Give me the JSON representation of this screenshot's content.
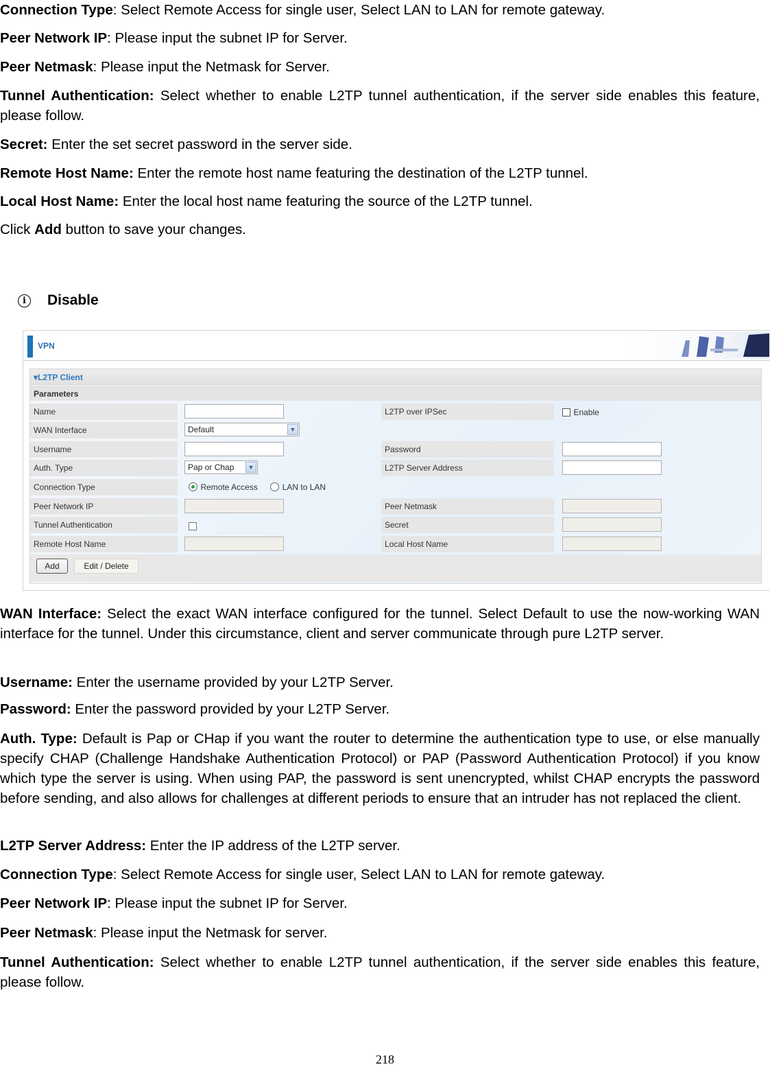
{
  "top_paragraphs": [
    {
      "term": "Connection Type",
      "sep": ":",
      "text": " Select Remote Access for single user, Select LAN to LAN for remote gateway."
    },
    {
      "term": "Peer Network IP",
      "sep": ":",
      "text": " Please input the subnet IP for Server."
    },
    {
      "term": "Peer Netmask",
      "sep": ":",
      "text": " Please input the Netmask for Server."
    },
    {
      "term": "Tunnel Authentication:",
      "sep": "",
      "text": " Select whether to enable L2TP tunnel authentication, if the server side enables this feature, please follow."
    },
    {
      "term": "Secret:",
      "sep": "",
      "text": " Enter the set secret password in the server side."
    },
    {
      "term": "Remote Host Name:",
      "sep": "",
      "text": " Enter the remote host name featuring the destination of the L2TP tunnel."
    },
    {
      "term": "Local Host Name:",
      "sep": "",
      "text": " Enter the local host name featuring the source of the L2TP tunnel."
    }
  ],
  "click_add": {
    "prefix": "Click ",
    "term": "Add",
    "suffix": " button to save your changes."
  },
  "section": {
    "icon": "info-icon",
    "title": "Disable"
  },
  "ui": {
    "header_title": "VPN",
    "accent_color": "#1f73b7",
    "client_title": "▾L2TP Client",
    "params_title": "Parameters",
    "rows": [
      {
        "left_label": "Name",
        "right_label": "L2TP over IPSec",
        "right_option": "Enable"
      },
      {
        "left_label": "WAN Interface",
        "left_value": "Default"
      },
      {
        "left_label": "Username",
        "right_label": "Password"
      },
      {
        "left_label": "Auth. Type",
        "left_value": "Pap or Chap",
        "right_label": "L2TP Server Address"
      },
      {
        "left_label": "Connection Type",
        "options": [
          "Remote Access",
          "LAN to LAN"
        ],
        "selected": "Remote Access"
      },
      {
        "left_label": "Peer Network IP",
        "right_label": "Peer Netmask"
      },
      {
        "left_label": "Tunnel Authentication",
        "right_label": "Secret"
      },
      {
        "left_label": "Remote Host Name",
        "right_label": "Local Host Name"
      }
    ],
    "buttons": {
      "add": "Add",
      "edit_delete": "Edit / Delete"
    }
  },
  "bottom_paragraphs": [
    {
      "term": "WAN Interface:",
      "sep": "",
      "text": " Select the exact WAN interface configured for the tunnel. Select Default to use the now-working WAN interface for the tunnel. Under this circumstance, client and server communicate through pure L2TP server."
    },
    {
      "term": "Username:",
      "sep": "",
      "text": " Enter the username provided by your L2TP Server."
    },
    {
      "term": "Password:",
      "sep": "",
      "text": " Enter the password provided by your L2TP Server."
    },
    {
      "term": "Auth. Type:",
      "sep": "",
      "text": " Default is Pap or CHap if you want the router to determine the authentication type to use, or else manually specify CHAP (Challenge Handshake Authentication Protocol) or PAP (Password Authentication Protocol) if you know which type the server is using. When using PAP, the password is sent unencrypted, whilst CHAP encrypts the password before sending, and also allows for challenges at different periods to ensure that an intruder has not replaced the client."
    },
    {
      "term": "L2TP Server Address:",
      "sep": "",
      "text": " Enter the IP address of the L2TP server."
    },
    {
      "term": "Connection Type",
      "sep": ":",
      "text": " Select Remote Access for single user, Select LAN to LAN for remote gateway."
    },
    {
      "term": "Peer Network IP",
      "sep": ":",
      "text": " Please input the subnet IP for Server."
    },
    {
      "term": "Peer Netmask",
      "sep": ":",
      "text": " Please input the Netmask for server."
    },
    {
      "term": "Tunnel Authentication:",
      "sep": "",
      "text": " Select whether to enable L2TP tunnel authentication, if the server side enables this feature, please follow."
    }
  ],
  "page_number": "218"
}
